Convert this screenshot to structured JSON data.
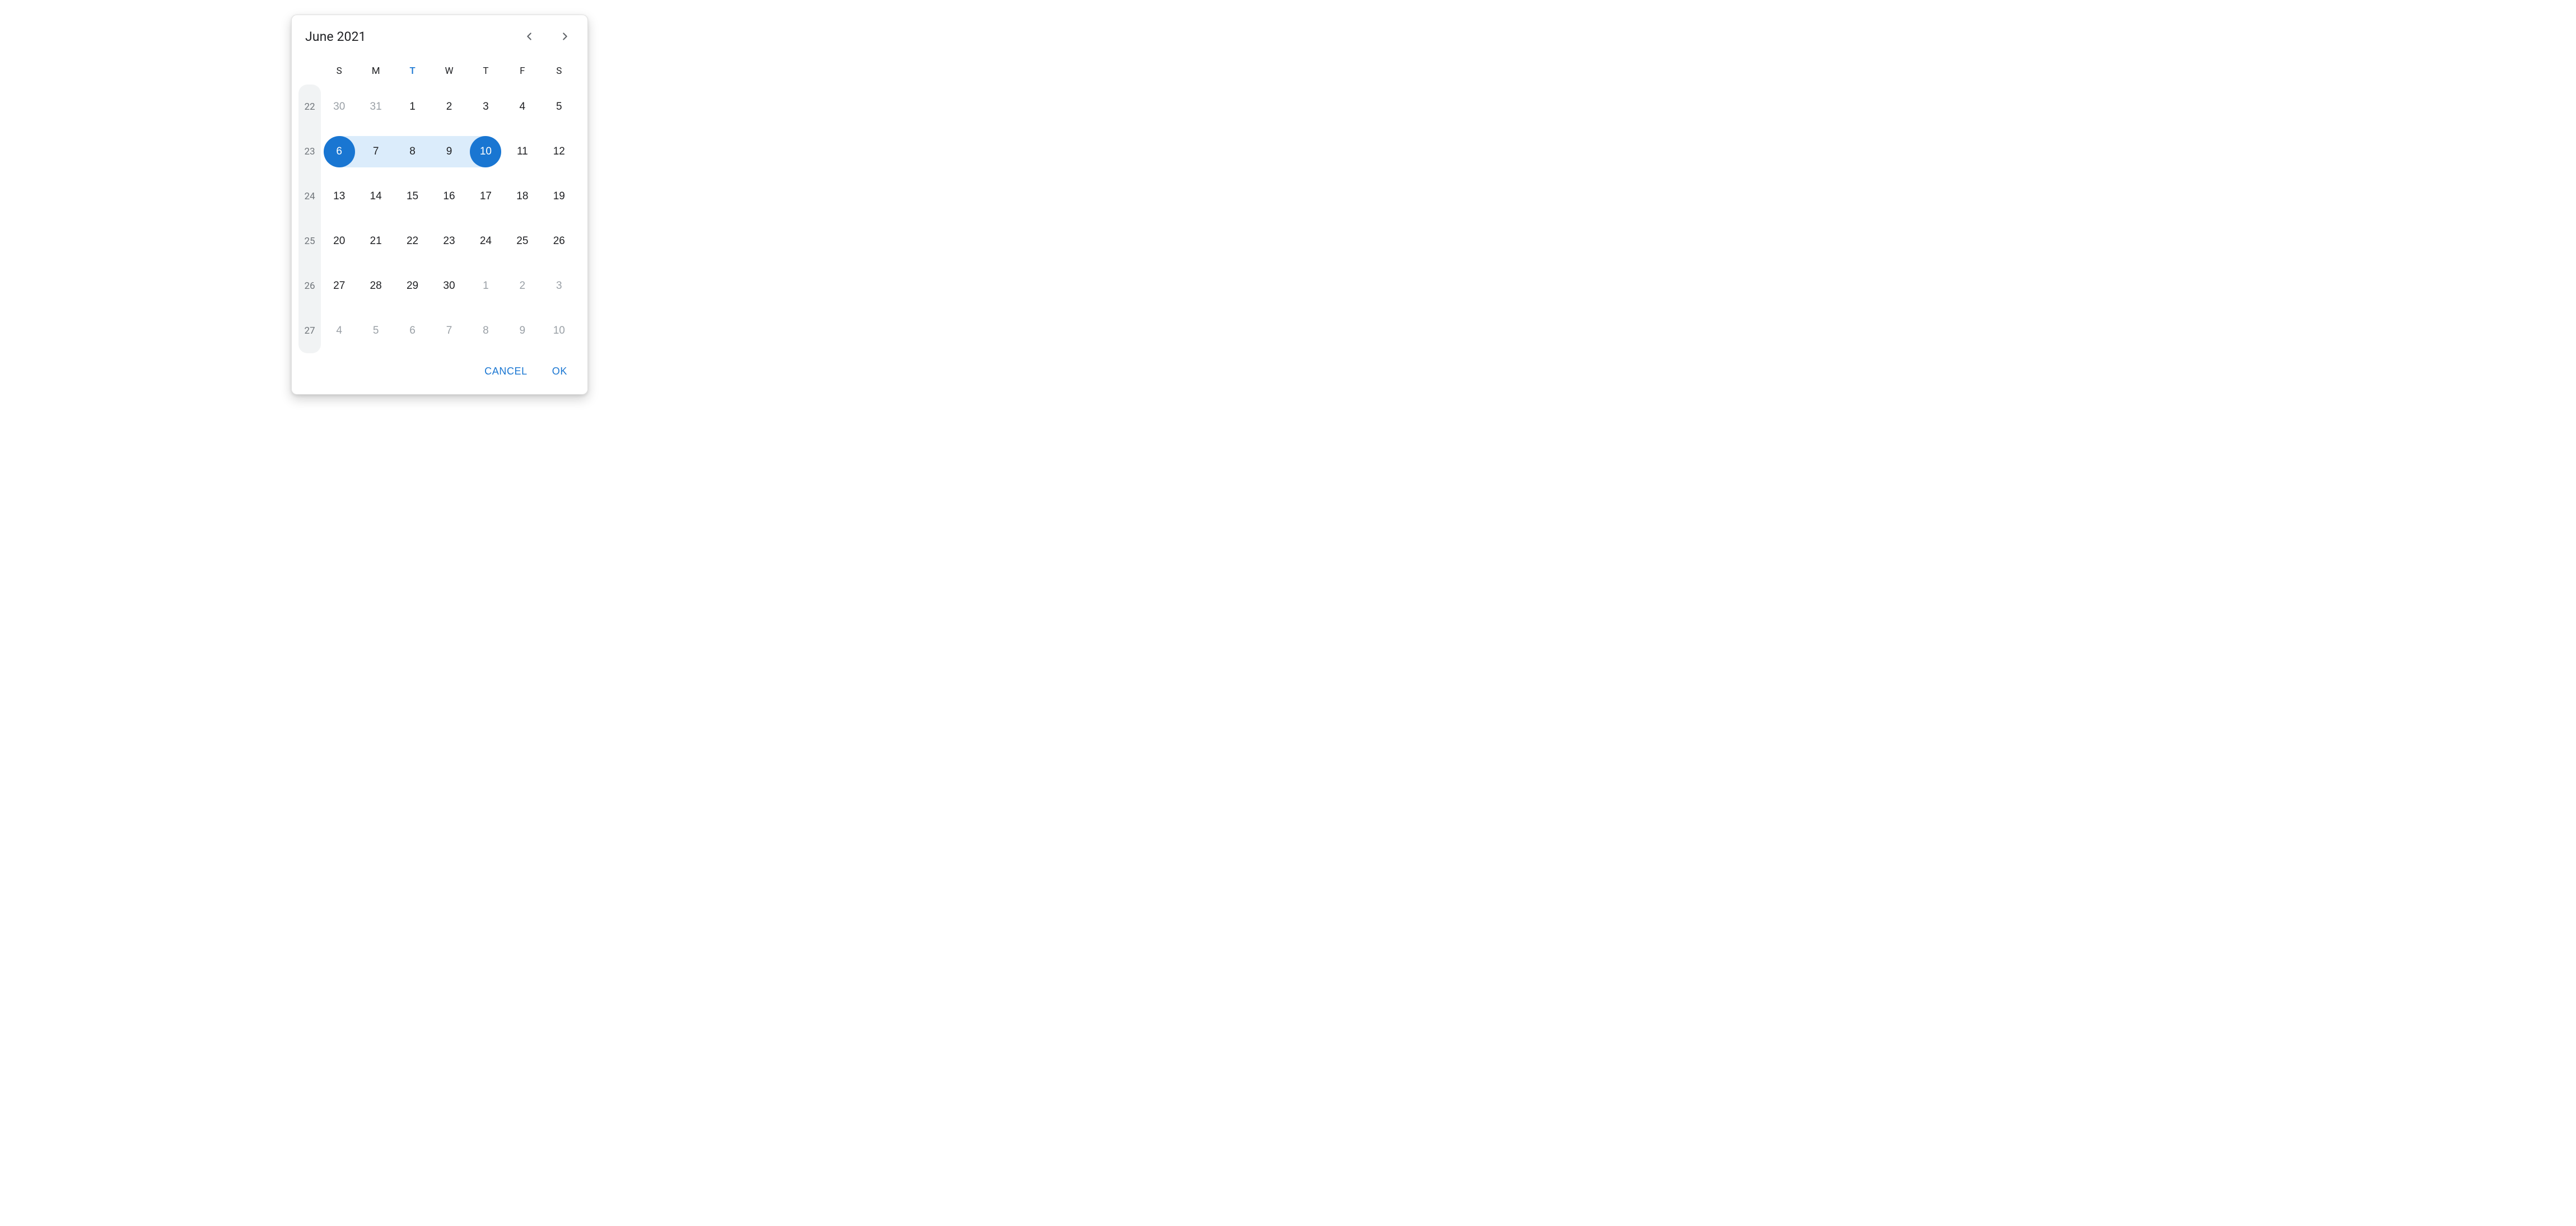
{
  "colors": {
    "accent": "#1976d2",
    "range_bg": "#dbecfb"
  },
  "calendar": {
    "month_label": "June 2021",
    "weekdays": [
      "S",
      "M",
      "T",
      "W",
      "T",
      "F",
      "S"
    ],
    "today_weekday_index": 2,
    "week_numbers": [
      22,
      23,
      24,
      25,
      26,
      27
    ],
    "selection": {
      "start": 6,
      "end": 10
    },
    "rows": [
      [
        {
          "n": 30,
          "outside": true
        },
        {
          "n": 31,
          "outside": true
        },
        {
          "n": 1
        },
        {
          "n": 2
        },
        {
          "n": 3
        },
        {
          "n": 4
        },
        {
          "n": 5
        }
      ],
      [
        {
          "n": 6,
          "selected": true,
          "in_range": true,
          "range_start": true
        },
        {
          "n": 7,
          "in_range": true
        },
        {
          "n": 8,
          "in_range": true
        },
        {
          "n": 9,
          "in_range": true
        },
        {
          "n": 10,
          "selected": true,
          "in_range": true,
          "range_end": true
        },
        {
          "n": 11
        },
        {
          "n": 12
        }
      ],
      [
        {
          "n": 13
        },
        {
          "n": 14
        },
        {
          "n": 15
        },
        {
          "n": 16
        },
        {
          "n": 17
        },
        {
          "n": 18
        },
        {
          "n": 19
        }
      ],
      [
        {
          "n": 20
        },
        {
          "n": 21
        },
        {
          "n": 22
        },
        {
          "n": 23
        },
        {
          "n": 24
        },
        {
          "n": 25
        },
        {
          "n": 26
        }
      ],
      [
        {
          "n": 27
        },
        {
          "n": 28
        },
        {
          "n": 29
        },
        {
          "n": 30
        },
        {
          "n": 1,
          "outside": true
        },
        {
          "n": 2,
          "outside": true
        },
        {
          "n": 3,
          "outside": true
        }
      ],
      [
        {
          "n": 4,
          "outside": true
        },
        {
          "n": 5,
          "outside": true
        },
        {
          "n": 6,
          "outside": true
        },
        {
          "n": 7,
          "outside": true
        },
        {
          "n": 8,
          "outside": true
        },
        {
          "n": 9,
          "outside": true
        },
        {
          "n": 10,
          "outside": true
        }
      ]
    ]
  },
  "actions": {
    "cancel_label": "CANCEL",
    "ok_label": "OK"
  }
}
